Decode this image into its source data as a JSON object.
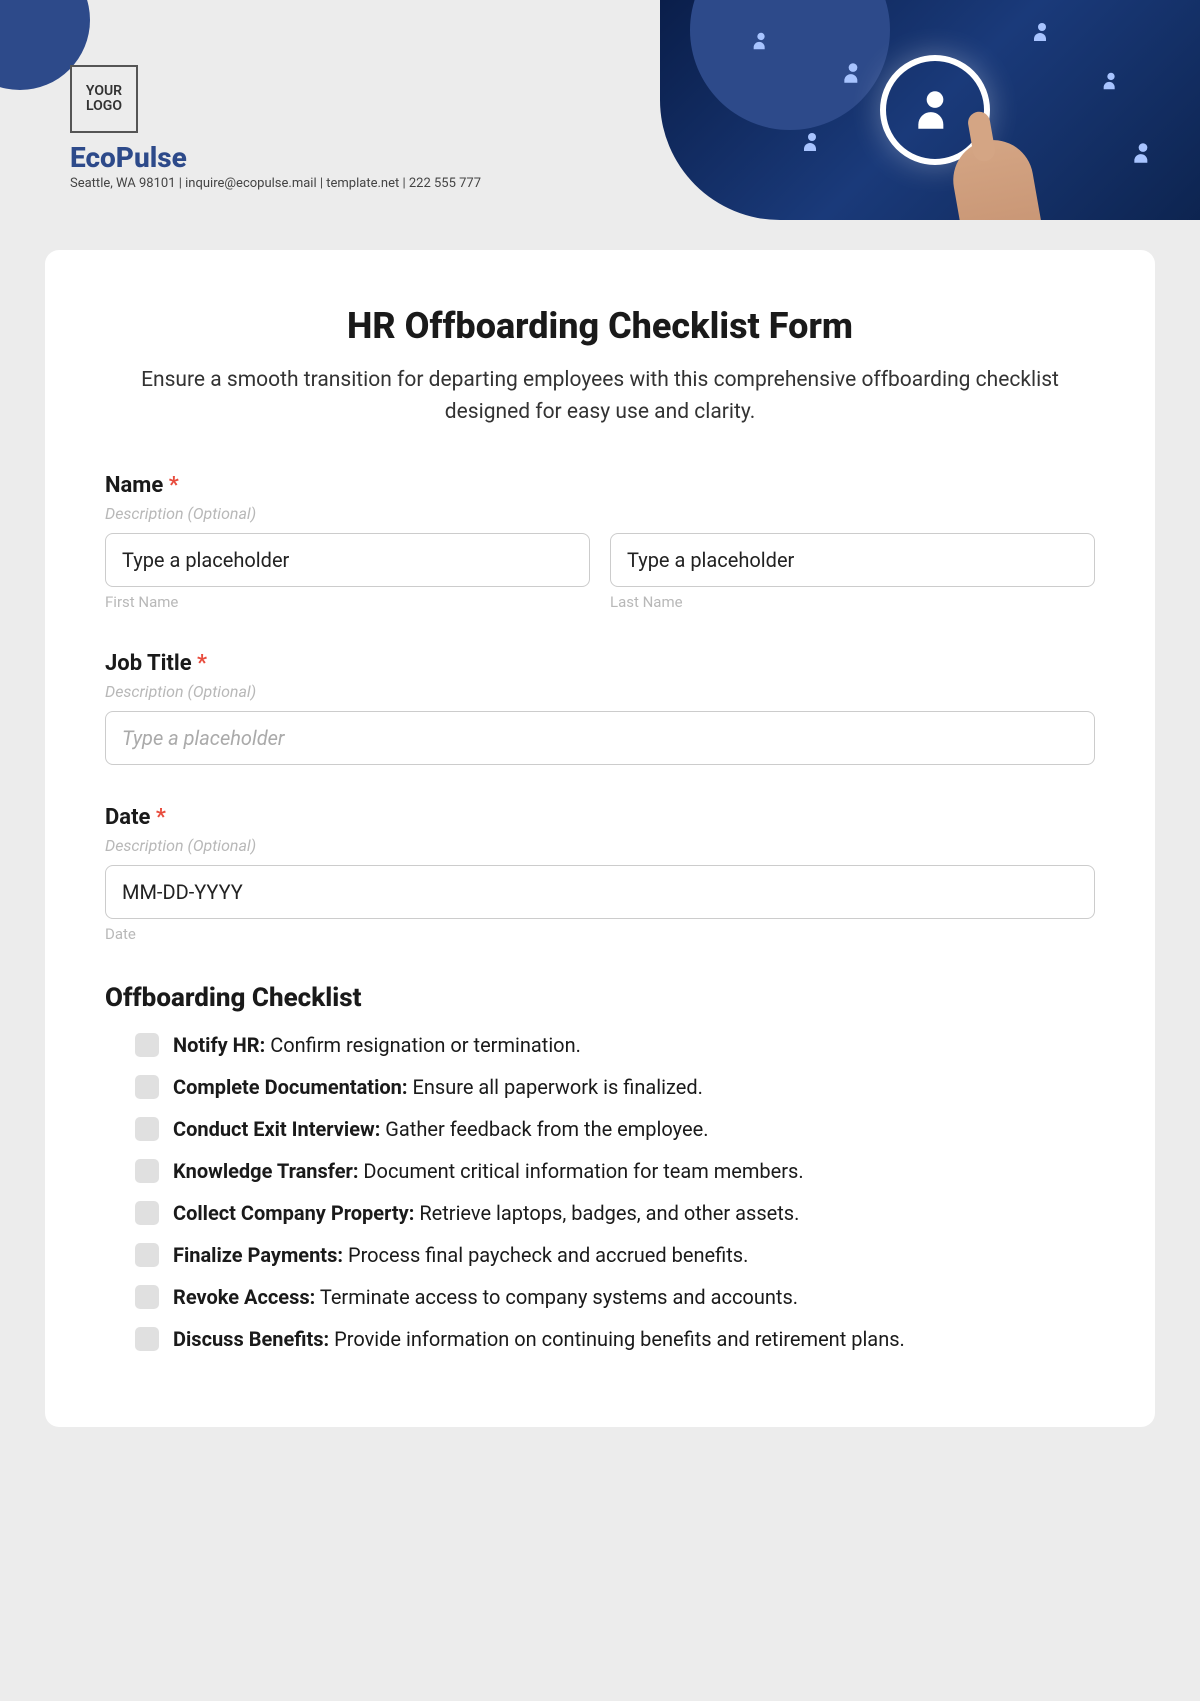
{
  "brand": {
    "logo_text": "YOUR\nLOGO",
    "name": "EcoPulse",
    "info": "Seattle, WA 98101 | inquire@ecopulse.mail | template.net | 222 555 777"
  },
  "form": {
    "title": "HR Offboarding Checklist Form",
    "description": "Ensure a smooth transition for departing employees with this comprehensive offboarding checklist designed for easy use and clarity."
  },
  "fields": {
    "name": {
      "label": "Name",
      "hint": "Description (Optional)",
      "first_placeholder": "Type a placeholder",
      "first_sublabel": "First Name",
      "last_placeholder": "Type a placeholder",
      "last_sublabel": "Last Name"
    },
    "job_title": {
      "label": "Job Title",
      "hint": "Description (Optional)",
      "placeholder": "Type a placeholder"
    },
    "date": {
      "label": "Date",
      "hint": "Description (Optional)",
      "placeholder": "MM-DD-YYYY",
      "sublabel": "Date"
    }
  },
  "checklist": {
    "title": "Offboarding Checklist",
    "items": [
      {
        "bold": "Notify HR:",
        "text": " Confirm resignation or termination."
      },
      {
        "bold": "Complete Documentation:",
        "text": " Ensure all paperwork is finalized."
      },
      {
        "bold": "Conduct Exit Interview:",
        "text": " Gather feedback from the employee."
      },
      {
        "bold": "Knowledge Transfer:",
        "text": " Document critical information for team members."
      },
      {
        "bold": "Collect Company Property:",
        "text": " Retrieve laptops, badges, and other assets."
      },
      {
        "bold": "Finalize Payments:",
        "text": " Process final paycheck and accrued benefits."
      },
      {
        "bold": "Revoke Access:",
        "text": " Terminate access to company systems and accounts."
      },
      {
        "bold": "Discuss Benefits:",
        "text": " Provide information on continuing benefits and retirement plans."
      }
    ]
  }
}
